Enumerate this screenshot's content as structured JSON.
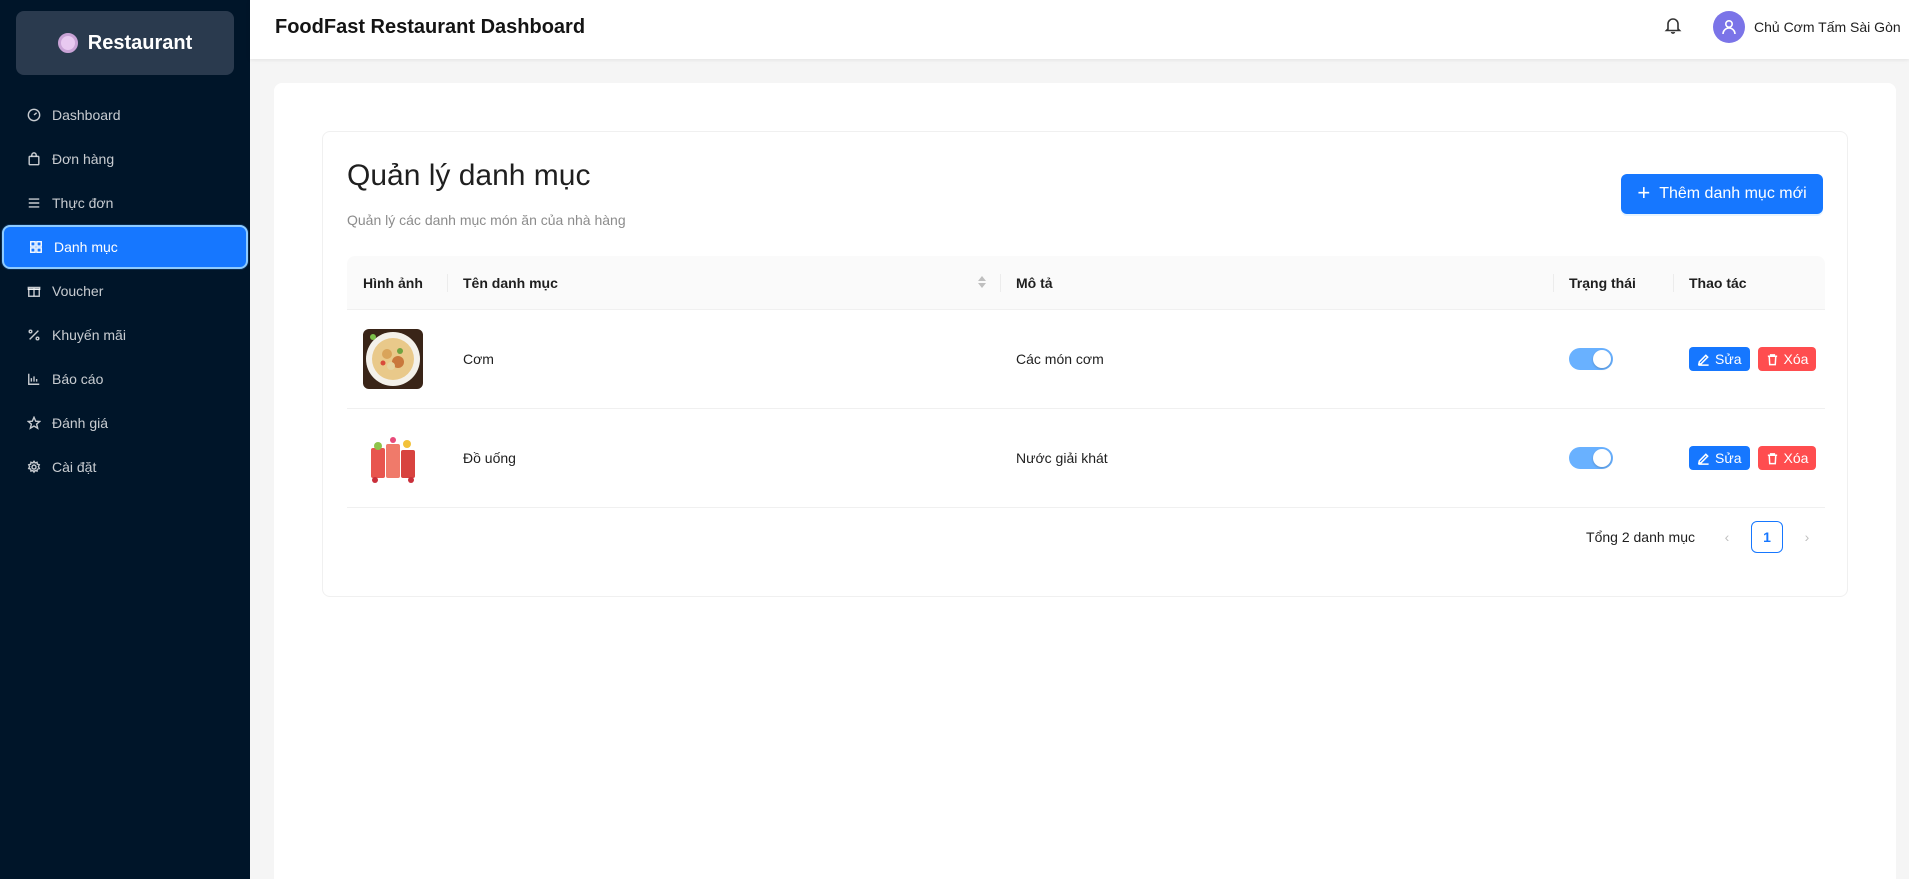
{
  "brand": {
    "name": "Restaurant",
    "icon": "plate-icon"
  },
  "sidebar": {
    "items": [
      {
        "label": "Dashboard",
        "icon": "dashboard-icon"
      },
      {
        "label": "Đơn hàng",
        "icon": "shopping-bag-icon"
      },
      {
        "label": "Thực đơn",
        "icon": "menu-lines-icon"
      },
      {
        "label": "Danh mục",
        "icon": "grid-icon",
        "active": true
      },
      {
        "label": "Voucher",
        "icon": "gift-icon"
      },
      {
        "label": "Khuyến mãi",
        "icon": "percent-icon"
      },
      {
        "label": "Báo cáo",
        "icon": "bar-chart-icon"
      },
      {
        "label": "Đánh giá",
        "icon": "star-icon"
      },
      {
        "label": "Cài đặt",
        "icon": "gear-icon"
      }
    ]
  },
  "header": {
    "title": "FoodFast Restaurant Dashboard",
    "user_name": "Chủ Cơm Tấm Sài Gòn"
  },
  "main": {
    "title": "Quản lý danh mục",
    "subtitle": "Quản lý các danh mục món ăn của nhà hàng",
    "add_button": "Thêm danh mục mới",
    "table": {
      "columns": [
        "Hình ảnh",
        "Tên danh mục",
        "Mô tả",
        "Trạng thái",
        "Thao tác"
      ],
      "rows": [
        {
          "name": "Cơm",
          "description": "Các món cơm",
          "active": true,
          "image": "rice-dish-image"
        },
        {
          "name": "Đồ uống",
          "description": "Nước giải khát",
          "active": true,
          "image": "drinks-image"
        }
      ],
      "edit_label": "Sửa",
      "delete_label": "Xóa"
    },
    "pagination": {
      "total_text": "Tổng 2 danh mục",
      "current_page": "1"
    }
  },
  "colors": {
    "sidebar_bg": "#001529",
    "primary": "#1677ff",
    "danger": "#ff4d4f",
    "toggle_on": "#69b1ff"
  }
}
